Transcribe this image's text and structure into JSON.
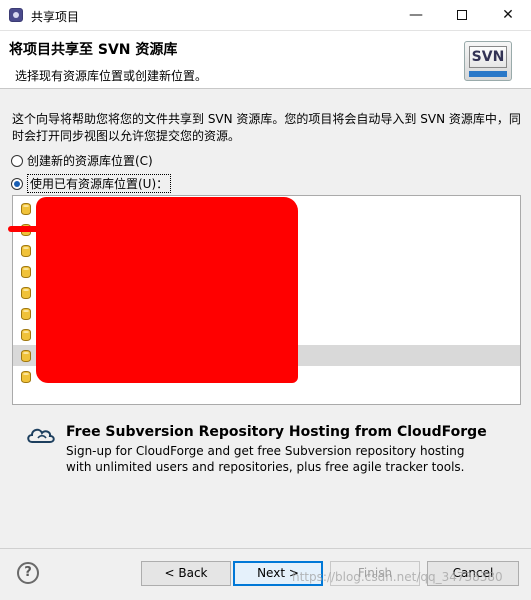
{
  "window": {
    "title": "共享项目",
    "minimize_glyph": "—",
    "close_glyph": "✕"
  },
  "banner": {
    "heading": "将项目共享至 SVN 资源库",
    "description": "选择现有资源库位置或创建新位置。",
    "logo_text": "SVN"
  },
  "intro_text": "这个向导将帮助您将您的文件共享到 SVN 资源库。您的项目将会自动导入到 SVN 资源库中，同时会打开同步视图以允许您提交您的资源。",
  "options": {
    "create_new": {
      "label": "创建新的资源库位置(C)",
      "checked": false
    },
    "use_existing": {
      "label": "使用已有资源库位置(U)：",
      "checked": true
    }
  },
  "repository_list": {
    "row_count": 9,
    "selected_index": 7,
    "labels_redacted": true
  },
  "cloudforge": {
    "title": "Free Subversion Repository Hosting from CloudForge",
    "description": "Sign-up for CloudForge and get free Subversion repository hosting with unlimited users and repositories, plus free agile tracker tools."
  },
  "buttons": {
    "help": "?",
    "back": "< Back",
    "next": "Next >",
    "finish": "Finish",
    "cancel": "Cancel"
  },
  "watermark": "https://blog.csdn.net/qq_34738380",
  "colors": {
    "accent": "#0078d7",
    "selection": "#d9d9d9",
    "redaction": "#ff0000",
    "repo_icon": "#f0c23a"
  }
}
